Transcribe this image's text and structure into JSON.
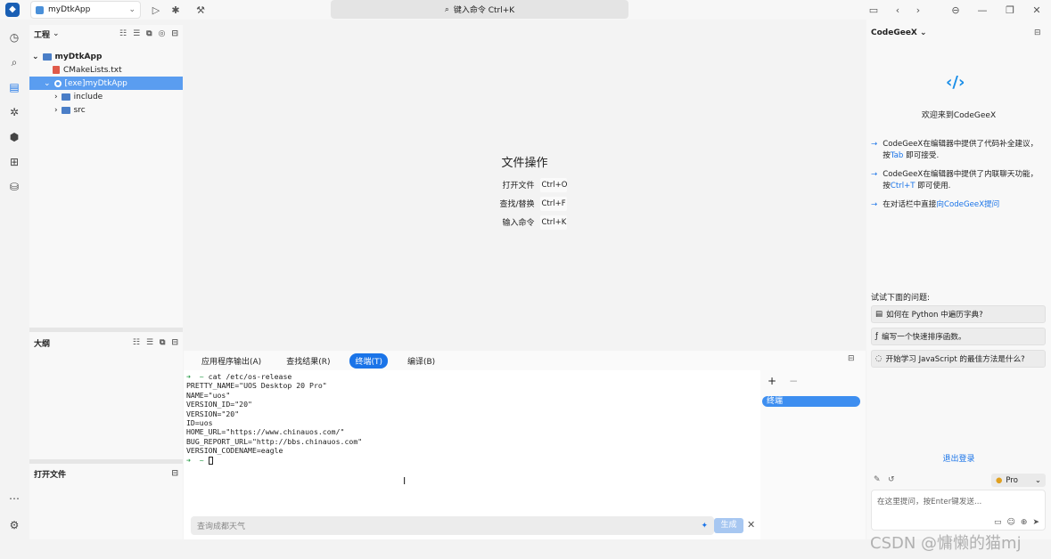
{
  "titlebar": {
    "project_name": "myDtkApp",
    "command_label": "键入命令 Ctrl+K",
    "chevron": "chevron-down-icon"
  },
  "activity_icons": [
    "history-icon",
    "search-icon",
    "edit-icon",
    "bug-icon",
    "package-icon",
    "extensions-icon",
    "database-icon"
  ],
  "project_panel": {
    "title": "工程",
    "tree": [
      {
        "label": "myDtkApp",
        "level": 0,
        "kind": "folder",
        "expanded": true
      },
      {
        "label": "CMakeLists.txt",
        "level": 1,
        "kind": "file"
      },
      {
        "label": "[exe]myDtkApp",
        "level": 1,
        "kind": "target",
        "selected": true,
        "expanded": true
      },
      {
        "label": "include",
        "level": 2,
        "kind": "folder"
      },
      {
        "label": "src",
        "level": 2,
        "kind": "folder"
      }
    ]
  },
  "outline_panel": {
    "title": "大纲"
  },
  "open_files_panel": {
    "title": "打开文件"
  },
  "welcome": {
    "title": "文件操作",
    "rows": [
      {
        "label": "打开文件",
        "shortcut": "Ctrl+O"
      },
      {
        "label": "查找/替换",
        "shortcut": "Ctrl+F"
      },
      {
        "label": "输入命令",
        "shortcut": "Ctrl+K"
      }
    ]
  },
  "bottom_panel": {
    "tabs": [
      "应用程序输出(A)",
      "查找结果(R)",
      "终端(T)",
      "编译(B)"
    ],
    "active_tab": 2,
    "terminal_lines": [
      "cat /etc/os-release",
      "PRETTY_NAME=\"UOS Desktop 20 Pro\"",
      "NAME=\"uos\"",
      "VERSION_ID=\"20\"",
      "VERSION=\"20\"",
      "ID=uos",
      "HOME_URL=\"https://www.chinauos.com/\"",
      "BUG_REPORT_URL=\"http://bbs.chinauos.com\"",
      "VERSION_CODENAME=eagle"
    ],
    "terminal_list_item": "终端",
    "ask_placeholder": "查询成都天气",
    "generate_label": "生成"
  },
  "codegeex": {
    "title": "CodeGeeX",
    "welcome": "欢迎来到CodeGeeX",
    "tips": [
      {
        "pre": "CodeGeeX在编辑器中提供了代码补全建议，按",
        "key": "Tab",
        "post": "即可接受."
      },
      {
        "pre": "CodeGeeX在编辑器中提供了内联聊天功能，按",
        "key": "Ctrl+T",
        "post": "即可使用."
      },
      {
        "pre": "在对话栏中直接",
        "key": "向CodeGeeX提问",
        "post": ""
      }
    ],
    "try_title": "试试下面的问题:",
    "questions": [
      {
        "icon": "table-icon",
        "text": "如何在 Python 中遍历字典?"
      },
      {
        "icon": "function-icon",
        "text": "编写一个快速排序函数。"
      },
      {
        "icon": "chat-icon",
        "text": "开始学习 JavaScript 的最佳方法是什么?"
      }
    ],
    "logout": "退出登录",
    "model": "Pro",
    "input_placeholder": "在这里提问，按Enter键发送..."
  },
  "watermark": "CSDN @慵懒的猫mj",
  "colors": {
    "accent": "#1a74e8",
    "selection": "#5a9df0"
  }
}
